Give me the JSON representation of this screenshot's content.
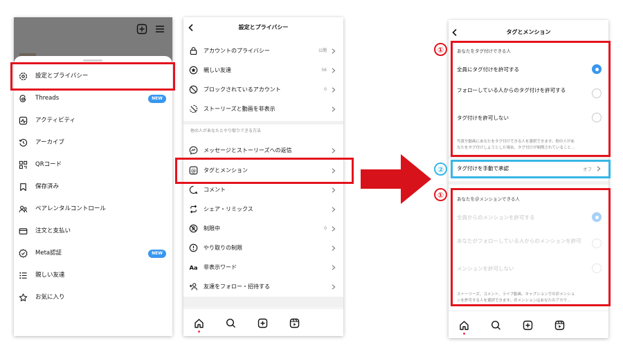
{
  "screen1": {
    "menu_items": [
      {
        "label": "設定とプライバシー",
        "icon": "gear-icon"
      },
      {
        "label": "Threads",
        "icon": "threads-icon",
        "badge": "NEW"
      },
      {
        "label": "アクティビティ",
        "icon": "activity-icon"
      },
      {
        "label": "アーカイブ",
        "icon": "archive-icon"
      },
      {
        "label": "QRコード",
        "icon": "qr-code-icon"
      },
      {
        "label": "保存済み",
        "icon": "bookmark-icon"
      },
      {
        "label": "ペアレンタルコントロール",
        "icon": "parental-control-icon"
      },
      {
        "label": "注文と支払い",
        "icon": "card-icon"
      },
      {
        "label": "Meta認証",
        "icon": "verified-icon",
        "badge": "NEW"
      },
      {
        "label": "親しい友達",
        "icon": "close-friends-list-icon"
      },
      {
        "label": "お気に入り",
        "icon": "star-icon"
      }
    ]
  },
  "screen2": {
    "title": "設定とプライバシー",
    "rows_top": [
      {
        "label": "アカウントのプライバシー",
        "value": "公開",
        "icon": "lock-icon"
      },
      {
        "label": "親しい友達",
        "value": "56",
        "icon": "star-circle-icon"
      },
      {
        "label": "ブロックされているアカウント",
        "value": "0",
        "icon": "block-icon"
      },
      {
        "label": "ストーリーズと動画を非表示",
        "value": "",
        "icon": "hide-story-icon"
      }
    ],
    "section_label": "他の人があなたとやり取りできる方法",
    "rows_bottom": [
      {
        "label": "メッセージとストーリーズへの返信",
        "value": "",
        "icon": "messenger-icon"
      },
      {
        "label": "タグとメンション",
        "value": "",
        "icon": "at-sign-icon"
      },
      {
        "label": "コメント",
        "value": "",
        "icon": "comment-icon"
      },
      {
        "label": "シェア・リミックス",
        "value": "",
        "icon": "remix-icon"
      },
      {
        "label": "制限中",
        "value": "0",
        "icon": "restricted-icon"
      },
      {
        "label": "やり取りの制限",
        "value": "",
        "icon": "limit-icon"
      },
      {
        "label": "非表示ワード",
        "value": "",
        "icon": "text-aa-icon"
      },
      {
        "label": "友達をフォロー・招待する",
        "value": "",
        "icon": "add-person-icon"
      }
    ]
  },
  "screen3": {
    "title": "タグとメンション",
    "tag_section": {
      "heading": "あなたをタグ付けできる人",
      "options": [
        {
          "label": "全員にタグ付けを許可する",
          "selected": true
        },
        {
          "label": "フォローしている人からのタグ付けを許可する",
          "selected": false
        },
        {
          "label": "タグ付けを許可しない",
          "selected": false
        }
      ],
      "note_lines": [
        "写真や動画にあなたをタグ付けできる人を選択できます。他の人があ",
        "なたをタグ付けしようとした場合、タグ付けが制限されていること…"
      ]
    },
    "manual_approve": {
      "label": "タグ付けを手動で承認",
      "value": "オフ"
    },
    "mention_section": {
      "heading": "あなたを＠メンションできる人",
      "options": [
        {
          "label": "全員からのメンションを許可する",
          "selected": true
        },
        {
          "label": "あなたがフォローしている人からのメンションを許可",
          "selected": false
        },
        {
          "label": "メンションを許可しない",
          "selected": false
        }
      ],
      "note_lines": [
        "ストーリーズ、コメント、ライブ動画、キャプションでの＠メンショ",
        "ンを許可する人を選択できます。＠メンションはあなたのアカウ…"
      ]
    }
  },
  "annotations": {
    "marker_1": "①",
    "marker_2": "②"
  },
  "colors": {
    "highlight_red": "#e3131d",
    "highlight_blue": "#36b6e6",
    "arrow_red": "#d8121b",
    "accent_blue": "#3897f0"
  }
}
